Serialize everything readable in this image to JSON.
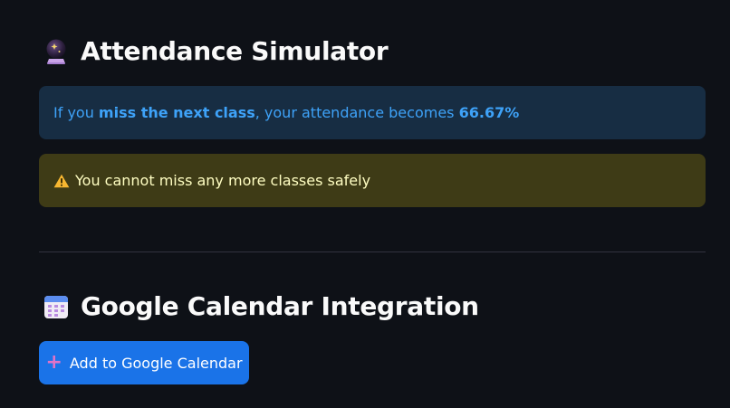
{
  "simulator": {
    "heading": "Attendance Simulator",
    "heading_icon": "crystal-ball-icon",
    "info": {
      "prefix": "If you ",
      "bold_action": "miss the next class",
      "middle": ", your attendance becomes ",
      "value": "66.67%",
      "color": "#3ea2f8",
      "background": "#172d43"
    },
    "warning": {
      "icon": "warning-icon",
      "text": "You cannot miss any more classes safely",
      "color": "#fffec2",
      "background": "#3e3b16"
    }
  },
  "calendar": {
    "heading": "Google Calendar Integration",
    "heading_icon": "calendar-icon",
    "button": {
      "label": "Add to Google Calendar",
      "icon": "plus-icon",
      "background": "#1a73e8"
    }
  }
}
